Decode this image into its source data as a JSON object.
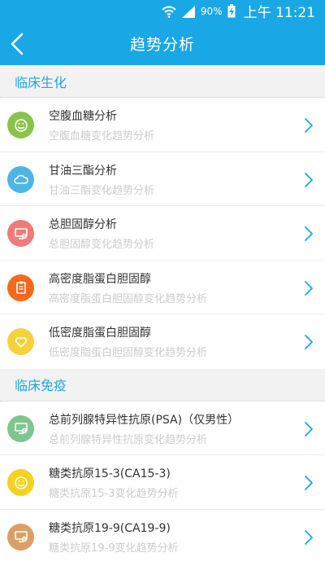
{
  "status_bar": {
    "battery": "90%",
    "time": "上午 11:21"
  },
  "header": {
    "title": "趋势分析"
  },
  "sections": [
    {
      "title": "临床生化",
      "items": [
        {
          "title": "空腹血糖分析",
          "subtitle": "空腹血糖变化趋势分析",
          "icon": "face-icon",
          "color": "#8bc34a"
        },
        {
          "title": "甘油三酯分析",
          "subtitle": "甘油三酯变化趋势分析",
          "icon": "cloud-icon",
          "color": "#4db6e6"
        },
        {
          "title": "总胆固醇分析",
          "subtitle": "总胆固醇变化趋势分析",
          "icon": "monitor-icon",
          "color": "#ef7b7b"
        },
        {
          "title": "高密度脂蛋白胆固醇",
          "subtitle": "高密度脂蛋白胆固醇变化趋势分析",
          "icon": "clipboard-icon",
          "color": "#f26a1b"
        },
        {
          "title": "低密度脂蛋白胆固醇",
          "subtitle": "低密度脂蛋白胆固醇变化趋势分析",
          "icon": "heart-icon",
          "color": "#f7d13b"
        }
      ]
    },
    {
      "title": "临床免疫",
      "items": [
        {
          "title": "总前列腺特异性抗原(PSA)（仅男性）",
          "subtitle": "总前列腺特异性抗原变化趋势分析",
          "icon": "monitor-icon",
          "color": "#7fc58f"
        },
        {
          "title": "糖类抗原15-3(CA15-3)",
          "subtitle": "糖类抗原15-3变化趋势分析",
          "icon": "face-icon",
          "color": "#f5d21f"
        },
        {
          "title": "糖类抗原19-9(CA19-9)",
          "subtitle": "糖类抗原19-9变化趋势分析",
          "icon": "monitor-icon",
          "color": "#d9a066"
        }
      ]
    }
  ]
}
